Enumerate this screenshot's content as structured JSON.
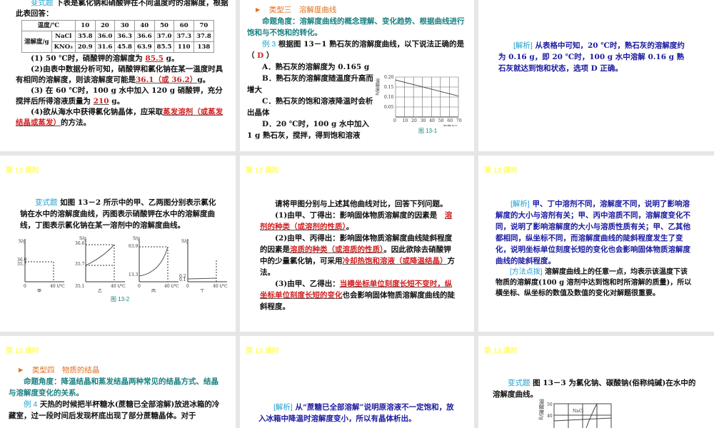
{
  "slide1": {
    "label": "变式题",
    "intro": "下表是氯化钠和硝酸钾在不同温度时的溶解度，根据此表回答：",
    "table": {
      "header": [
        "温度/℃",
        "10",
        "20",
        "30",
        "40",
        "50",
        "60",
        "70"
      ],
      "row_label": "溶解度/g",
      "rows": [
        [
          "NaCl",
          "35.8",
          "36.0",
          "36.3",
          "36.6",
          "37.0",
          "37.3",
          "37.8"
        ],
        [
          "KNO₃",
          "20.9",
          "31.6",
          "45.8",
          "63.9",
          "85.5",
          "110",
          "138"
        ]
      ]
    },
    "q1": "(1) 50 ℃时，硝酸钾的溶解度为",
    "a1": "85.5",
    "u1": "g。",
    "q2": "(2)由表中数据分析可知，硝酸钾和氯化钠在某一温度时具有相同的溶解度，则该溶解度可能是",
    "a2": "36.1（或 36.2）",
    "u2": "g。",
    "q3": "(3) 在 60 ℃时，100 g 水中加入 120 g 硝酸钾，充分搅拌后所得溶液质量为",
    "a3": "210",
    "u3": "g。",
    "q4": "(4)欲从海水中获得氯化钠晶体，应采取",
    "a4": "蒸发溶剂（或蒸发结晶或蒸发）",
    "u4": "的方法。"
  },
  "slide2": {
    "arrow": "►",
    "type": "类型三　溶解度曲线",
    "angle": "命题角度：溶解度曲线的概念理解、变化趋势、根据曲线进行饱和与不饱和的转化。",
    "ex_label": "例 3",
    "question": "根据图 13－1 熟石灰的溶解度曲线，以下说法正确的是",
    "answer": "D",
    "options": [
      "A．熟石灰的溶解度为 0.165 g",
      "B．熟石灰的溶解度随温度升高而增大",
      "C．熟石灰的饱和溶液降温时会析出晶体",
      "D．20 ℃时，100 g 水中加入 1 g 熟石灰，搅拌，得到饱和溶液"
    ],
    "figure_caption": "图 13-1",
    "chart_data": {
      "type": "line",
      "ylabel": "溶解度/g",
      "xlabel": "温度/℃",
      "x": [
        0,
        70
      ],
      "y": [
        0.185,
        0.105
      ],
      "xticks": [
        "0",
        "10",
        "20",
        "30",
        "40",
        "50",
        "60",
        "70"
      ],
      "yticks": [
        "0.05",
        "0.10",
        "0.15",
        "0.20"
      ],
      "xlim": [
        0,
        70
      ],
      "ylim": [
        0,
        0.2
      ]
    }
  },
  "slide3": {
    "label": "[解析]",
    "text": "从表格中可知，20 ℃时，熟石灰的溶解度约为 0.16 g，即 20 ℃时，100 g 水中溶解 0.16 g 熟石灰就达到饱和状态，选项 D 正确。"
  },
  "header": "第 13 课时",
  "slide4": {
    "label": "变式题",
    "text": "如图 13－2 所示中的甲、乙两图分别表示氯化钠在水中的溶解度曲线，丙图表示硝酸钾在水中的溶解度曲线，丁图表示氯化钠在某一溶剂中的溶解度曲线。",
    "ylabel": "S/g",
    "xlabel": "40 t/℃",
    "zero": "0",
    "charts": [
      {
        "name": "甲",
        "ticks": [
          "36.0",
          "35.7"
        ]
      },
      {
        "name": "乙",
        "ticks": [
          "36.6",
          "35.7",
          "35.1"
        ]
      },
      {
        "name": "丙",
        "ticks": [
          "63.9",
          "13.3"
        ]
      },
      {
        "name": "丁",
        "ticks": [
          "0.2",
          "0.1"
        ]
      }
    ],
    "caption": "图 13-2"
  },
  "slide5": {
    "intro": "请将甲图分别与上述其他曲线对比，回答下列问题。",
    "q1": "(1)由甲、丁得出：影响固体物质溶解度的因素是",
    "a1": "溶剂的种类（或溶剂的性质）",
    "q2a": "(2)由甲、丙得出：影响固体物质溶解度曲线陡斜程度的因素是",
    "a2": "溶质的种类（或溶质的性质）",
    "q2b": "。因此欲除去硝酸钾中的少量氯化钠，可采用",
    "a2b": "冷却热饱和溶液（或降温结晶）",
    "q2c": "方法。",
    "q3": "(3)由甲、乙得出：",
    "a3": "当横坐标单位刻度长短不变时，纵坐标单位刻度长短的变化",
    "q3b": "也会影响固体物质溶解度曲线的陡斜程度。"
  },
  "slide6": {
    "label": "[解析]",
    "text": "甲、丁中溶剂不同，溶解度不同，说明了影响溶解度的大小与溶剂有关；甲、丙中溶质不同，溶解度变化不同，说明了影响溶解度的大小与溶质性质有关；甲、乙其他都相同，纵坐标不同，而溶解度曲线的陡斜程度发生了变化，说明坐标单位刻度长短的变化也会影响固体物质溶解度曲线的陡斜程度。",
    "tip_label": "[方法点拨]",
    "tip": "溶解度曲线上的任意一点，均表示该温度下该物质的溶解度(100 g 溶剂中达到饱和时所溶解的质量)，所以横坐标、纵坐标的数值及数值的变化对解题很重要。"
  },
  "slide7": {
    "arrow": "►",
    "type": "类型四　物质的结晶",
    "angle": "命题角度：降温结晶和蒸发结晶两种常见的结晶方式、结晶与溶解度变化的关系。",
    "ex_label": "例 4",
    "text": "天热的时候把半杯糖水(蔗糖已全部溶解)放进冰箱的冷藏室，过一段时间后发现杯底出现了部分蔗糖晶体。对于"
  },
  "slide8": {
    "label": "[解析]",
    "text": "从“蔗糖已全部溶解”说明原溶液不一定饱和，放入冰箱中降温时溶解度变小，所以有晶体析出。"
  },
  "slide9": {
    "label": "变式题",
    "text": "图 13－3 为氯化钠、碳酸钠(俗称纯碱)在水中的溶解度曲线。",
    "ylabel": "溶解度/g",
    "yticks": [
      "50",
      "40"
    ],
    "series_label": "NaCl"
  }
}
